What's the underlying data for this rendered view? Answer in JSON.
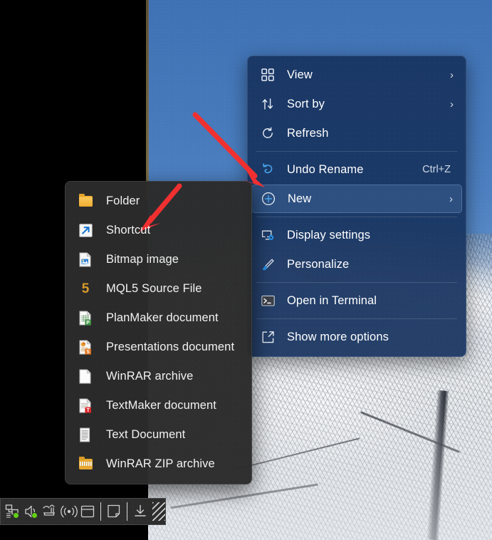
{
  "desktop": {
    "wallpaper_description": "frost covered tree against blue sky",
    "sky_color": "#4a80c0",
    "frost_color": "#e9ecef"
  },
  "context_menu": {
    "accent_highlight_color": "#5684be",
    "background_color": "#183460",
    "groups": [
      {
        "items": [
          {
            "label": "View",
            "icon": "grid-view-icon",
            "submenu": true,
            "accel": ""
          },
          {
            "label": "Sort by",
            "icon": "sort-arrows-icon",
            "submenu": true,
            "accel": ""
          },
          {
            "label": "Refresh",
            "icon": "refresh-icon",
            "submenu": false,
            "accel": ""
          }
        ]
      },
      {
        "items": [
          {
            "label": "Undo Rename",
            "icon": "undo-icon",
            "submenu": false,
            "accel": "Ctrl+Z"
          },
          {
            "label": "New",
            "icon": "plus-circle-icon",
            "submenu": true,
            "accel": "",
            "highlighted": true
          }
        ]
      },
      {
        "items": [
          {
            "label": "Display settings",
            "icon": "display-settings-icon",
            "submenu": false,
            "accel": ""
          },
          {
            "label": "Personalize",
            "icon": "brush-icon",
            "submenu": false,
            "accel": ""
          }
        ]
      },
      {
        "items": [
          {
            "label": "Open in Terminal",
            "icon": "terminal-icon",
            "submenu": false,
            "accel": ""
          }
        ]
      },
      {
        "items": [
          {
            "label": "Show more options",
            "icon": "show-more-options-icon",
            "submenu": false,
            "accel": ""
          }
        ]
      }
    ]
  },
  "new_submenu": {
    "background_color": "#2b2b2b",
    "items": [
      {
        "label": "Folder",
        "icon": "folder-icon"
      },
      {
        "label": "Shortcut",
        "icon": "shortcut-arrow-icon"
      },
      {
        "label": "Bitmap image",
        "icon": "bitmap-image-icon"
      },
      {
        "label": "MQL5 Source File",
        "icon": "mql5-icon"
      },
      {
        "label": "PlanMaker document",
        "icon": "planmaker-icon"
      },
      {
        "label": "Presentations document",
        "icon": "presentations-icon"
      },
      {
        "label": "WinRAR archive",
        "icon": "winrar-archive-icon"
      },
      {
        "label": "TextMaker document",
        "icon": "textmaker-icon"
      },
      {
        "label": "Text Document",
        "icon": "text-document-icon"
      },
      {
        "label": "WinRAR ZIP archive",
        "icon": "winrar-zip-icon"
      }
    ]
  },
  "annotations": {
    "arrow_color": "#f03030",
    "arrows": [
      {
        "name": "arrow-to-new",
        "points_to": "New"
      },
      {
        "name": "arrow-to-shortcut",
        "points_to": "Shortcut"
      }
    ]
  },
  "tray": {
    "background_color": "#2d2d2d",
    "buttons": [
      {
        "icon": "network-icon",
        "status_dot": "#63d015"
      },
      {
        "icon": "volume-icon",
        "status_dot": "#63d015"
      },
      {
        "icon": "input-method-icon",
        "status_dot": ""
      },
      {
        "icon": "wireless-broadcast-icon",
        "status_dot": ""
      },
      {
        "icon": "window-icon",
        "status_dot": ""
      },
      {
        "icon": "note-icon",
        "status_dot": ""
      },
      {
        "icon": "download-icon",
        "status_dot": ""
      }
    ]
  }
}
